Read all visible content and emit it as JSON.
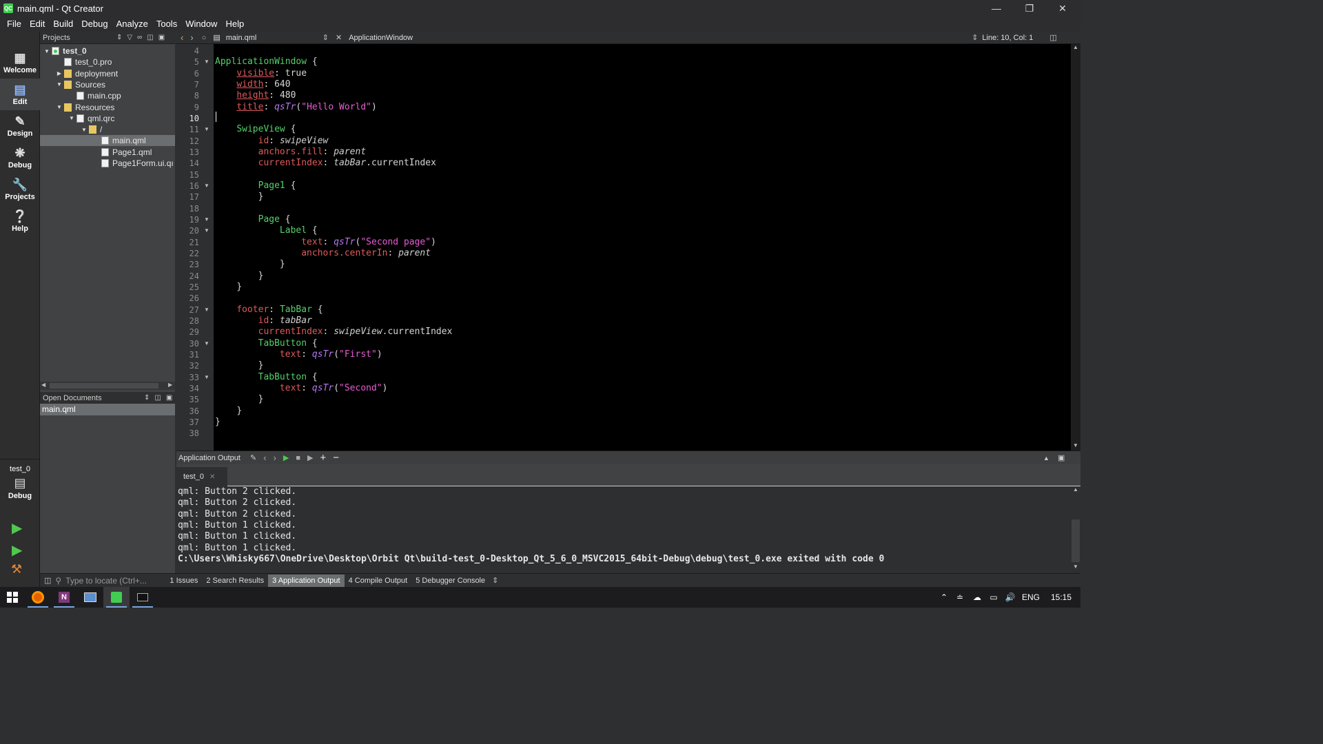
{
  "window": {
    "title": "main.qml - Qt Creator"
  },
  "menu": [
    "File",
    "Edit",
    "Build",
    "Debug",
    "Analyze",
    "Tools",
    "Window",
    "Help"
  ],
  "modes": [
    {
      "label": "Welcome",
      "icon": "grid-icon"
    },
    {
      "label": "Edit",
      "icon": "edit-icon",
      "active": true
    },
    {
      "label": "Design",
      "icon": "pencil-icon"
    },
    {
      "label": "Debug",
      "icon": "bug-icon"
    },
    {
      "label": "Projects",
      "icon": "wrench-icon"
    },
    {
      "label": "Help",
      "icon": "question-icon"
    }
  ],
  "kit": {
    "project": "test_0",
    "mode": "Debug"
  },
  "projects": {
    "header": "Projects",
    "tree": [
      {
        "label": "test_0",
        "depth": 0,
        "expanded": true,
        "icon": "project",
        "bold": true
      },
      {
        "label": "test_0.pro",
        "depth": 1,
        "icon": "doc"
      },
      {
        "label": "deployment",
        "depth": 1,
        "collapsed": true,
        "icon": "folder"
      },
      {
        "label": "Sources",
        "depth": 1,
        "expanded": true,
        "icon": "folder"
      },
      {
        "label": "main.cpp",
        "depth": 2,
        "icon": "doc"
      },
      {
        "label": "Resources",
        "depth": 1,
        "expanded": true,
        "icon": "folder"
      },
      {
        "label": "qml.qrc",
        "depth": 2,
        "expanded": true,
        "icon": "doc"
      },
      {
        "label": "/",
        "depth": 3,
        "expanded": true,
        "icon": "folder"
      },
      {
        "label": "main.qml",
        "depth": 4,
        "icon": "doc",
        "selected": true
      },
      {
        "label": "Page1.qml",
        "depth": 4,
        "icon": "doc"
      },
      {
        "label": "Page1Form.ui.qı",
        "depth": 4,
        "icon": "doc"
      }
    ]
  },
  "open_documents": {
    "header": "Open Documents",
    "items": [
      "main.qml"
    ]
  },
  "editor": {
    "file": "main.qml",
    "symbol": "ApplicationWindow",
    "position": "Line: 10, Col: 1",
    "current_line": 10,
    "first_line": 4,
    "fold_lines": [
      5,
      11,
      16,
      19,
      20,
      27,
      30,
      33
    ],
    "code": [
      [],
      [
        [
          "t",
          "ApplicationWindow"
        ],
        [
          "pl",
          " {"
        ]
      ],
      [
        [
          "n",
          "    "
        ],
        [
          "pu",
          "visible"
        ],
        [
          "pl",
          ": "
        ],
        [
          "n",
          "true"
        ]
      ],
      [
        [
          "n",
          "    "
        ],
        [
          "pu",
          "width"
        ],
        [
          "pl",
          ": "
        ],
        [
          "n",
          "640"
        ]
      ],
      [
        [
          "n",
          "    "
        ],
        [
          "pu",
          "height"
        ],
        [
          "pl",
          ": "
        ],
        [
          "n",
          "480"
        ]
      ],
      [
        [
          "n",
          "    "
        ],
        [
          "pu",
          "title"
        ],
        [
          "pl",
          ": "
        ],
        [
          "f",
          "qsTr"
        ],
        [
          "pl",
          "("
        ],
        [
          "s",
          "\"Hello World\""
        ],
        [
          "pl",
          ")"
        ]
      ],
      [],
      [
        [
          "n",
          "    "
        ],
        [
          "t",
          "SwipeView"
        ],
        [
          "pl",
          " {"
        ]
      ],
      [
        [
          "n",
          "        "
        ],
        [
          "p",
          "id"
        ],
        [
          "pl",
          ": "
        ],
        [
          "i",
          "swipeView"
        ]
      ],
      [
        [
          "n",
          "        "
        ],
        [
          "p",
          "anchors.fill"
        ],
        [
          "pl",
          ": "
        ],
        [
          "i",
          "parent"
        ]
      ],
      [
        [
          "n",
          "        "
        ],
        [
          "p",
          "currentIndex"
        ],
        [
          "pl",
          ": "
        ],
        [
          "i",
          "tabBar"
        ],
        [
          "pl",
          ".currentIndex"
        ]
      ],
      [],
      [
        [
          "n",
          "        "
        ],
        [
          "t",
          "Page1"
        ],
        [
          "pl",
          " {"
        ]
      ],
      [
        [
          "n",
          "        "
        ],
        [
          "pl",
          "}"
        ]
      ],
      [],
      [
        [
          "n",
          "        "
        ],
        [
          "t",
          "Page"
        ],
        [
          "pl",
          " {"
        ]
      ],
      [
        [
          "n",
          "            "
        ],
        [
          "t",
          "Label"
        ],
        [
          "pl",
          " {"
        ]
      ],
      [
        [
          "n",
          "                "
        ],
        [
          "p",
          "text"
        ],
        [
          "pl",
          ": "
        ],
        [
          "f",
          "qsTr"
        ],
        [
          "pl",
          "("
        ],
        [
          "s",
          "\"Second page\""
        ],
        [
          "pl",
          ")"
        ]
      ],
      [
        [
          "n",
          "                "
        ],
        [
          "p",
          "anchors.centerIn"
        ],
        [
          "pl",
          ": "
        ],
        [
          "i",
          "parent"
        ]
      ],
      [
        [
          "n",
          "            "
        ],
        [
          "pl",
          "}"
        ]
      ],
      [
        [
          "n",
          "        "
        ],
        [
          "pl",
          "}"
        ]
      ],
      [
        [
          "n",
          "    "
        ],
        [
          "pl",
          "}"
        ]
      ],
      [],
      [
        [
          "n",
          "    "
        ],
        [
          "p",
          "footer"
        ],
        [
          "pl",
          ": "
        ],
        [
          "t",
          "TabBar"
        ],
        [
          "pl",
          " {"
        ]
      ],
      [
        [
          "n",
          "        "
        ],
        [
          "p",
          "id"
        ],
        [
          "pl",
          ": "
        ],
        [
          "i",
          "tabBar"
        ]
      ],
      [
        [
          "n",
          "        "
        ],
        [
          "p",
          "currentIndex"
        ],
        [
          "pl",
          ": "
        ],
        [
          "i",
          "swipeView"
        ],
        [
          "pl",
          ".currentIndex"
        ]
      ],
      [
        [
          "n",
          "        "
        ],
        [
          "t",
          "TabButton"
        ],
        [
          "pl",
          " {"
        ]
      ],
      [
        [
          "n",
          "            "
        ],
        [
          "p",
          "text"
        ],
        [
          "pl",
          ": "
        ],
        [
          "f",
          "qsTr"
        ],
        [
          "pl",
          "("
        ],
        [
          "s",
          "\"First\""
        ],
        [
          "pl",
          ")"
        ]
      ],
      [
        [
          "n",
          "        "
        ],
        [
          "pl",
          "}"
        ]
      ],
      [
        [
          "n",
          "        "
        ],
        [
          "t",
          "TabButton"
        ],
        [
          "pl",
          " {"
        ]
      ],
      [
        [
          "n",
          "            "
        ],
        [
          "p",
          "text"
        ],
        [
          "pl",
          ": "
        ],
        [
          "f",
          "qsTr"
        ],
        [
          "pl",
          "("
        ],
        [
          "s",
          "\"Second\""
        ],
        [
          "pl",
          ")"
        ]
      ],
      [
        [
          "n",
          "        "
        ],
        [
          "pl",
          "}"
        ]
      ],
      [
        [
          "n",
          "    "
        ],
        [
          "pl",
          "}"
        ]
      ],
      [
        [
          "pl",
          "}"
        ]
      ],
      []
    ]
  },
  "output": {
    "header": "Application Output",
    "tab": "test_0",
    "lines": [
      "qml: Button 2 clicked.",
      "qml: Button 2 clicked.",
      "qml: Button 2 clicked.",
      "qml: Button 1 clicked.",
      "qml: Button 1 clicked.",
      "qml: Button 1 clicked."
    ],
    "exit_line": "C:\\Users\\Whisky667\\OneDrive\\Desktop\\Orbit Qt\\build-test_0-Desktop_Qt_5_6_0_MSVC2015_64bit-Debug\\debug\\test_0.exe exited with code 0"
  },
  "statusbar": {
    "locator_placeholder": "Type to locate (Ctrl+...",
    "panes": [
      "1  Issues",
      "2  Search Results",
      "3  Application Output",
      "4  Compile Output",
      "5  Debugger Console"
    ],
    "active_pane": 2
  },
  "taskbar": {
    "time": "15:15",
    "lang": "ENG"
  }
}
